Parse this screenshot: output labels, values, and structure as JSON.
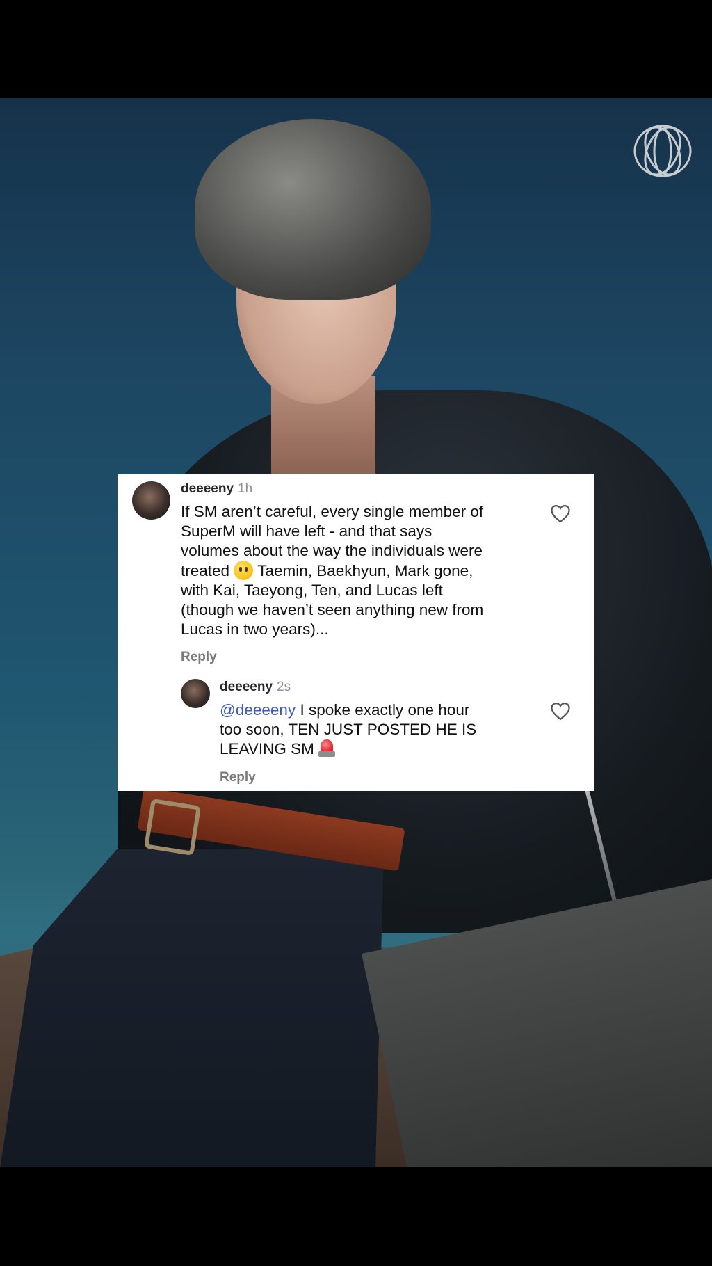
{
  "comment": {
    "username": "deeeeny",
    "time": "1h",
    "text_lines": [
      "If SM aren’t careful, every single member of",
      "SuperM will have left - and that says",
      "volumes about the way the individuals were",
      "treated",
      "Taemin, Baekhyun, Mark gone,",
      "with Kai, Taeyong, Ten, and Lucas left",
      "(though we haven’t seen anything new from",
      "Lucas in two years)..."
    ],
    "reply_label": "Reply"
  },
  "reply": {
    "username": "deeeeny",
    "time": "2s",
    "mention": "@deeeeny",
    "text_lines": [
      "I spoke exactly one hour",
      "too soon, TEN JUST POSTED HE IS",
      "LEAVING SM"
    ],
    "reply_label": "Reply"
  },
  "icons": {
    "like": "heart-outline-icon",
    "emoji_1": "face-without-mouth-emoji",
    "emoji_2": "police-car-light-emoji",
    "logo": "nct-logo"
  }
}
